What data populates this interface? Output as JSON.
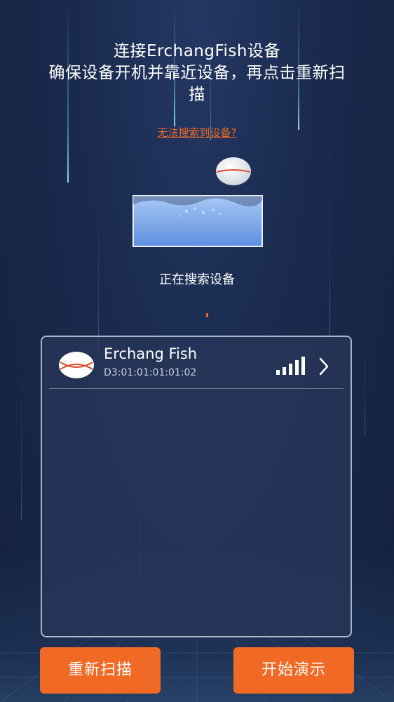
{
  "header": {
    "title_line1": "连接ErchangFish设备",
    "title_line2": "确保设备开机并靠近设备，再点击重新扫",
    "title_line3": "描"
  },
  "help_link": "无法搜索到设备?",
  "status": "正在搜索设备",
  "devices": [
    {
      "name": "Erchang Fish",
      "mac": "D3:01:01:01:01:02",
      "icon": "fish-finder-device-icon",
      "signal_bars": 5,
      "signal_active": 5
    }
  ],
  "buttons": {
    "rescan": "重新扫描",
    "demo": "开始演示"
  },
  "colors": {
    "accent": "#f06a25",
    "background": "#1a2a4d",
    "panel_border": "#becde1",
    "water": "#6f9fe6"
  }
}
